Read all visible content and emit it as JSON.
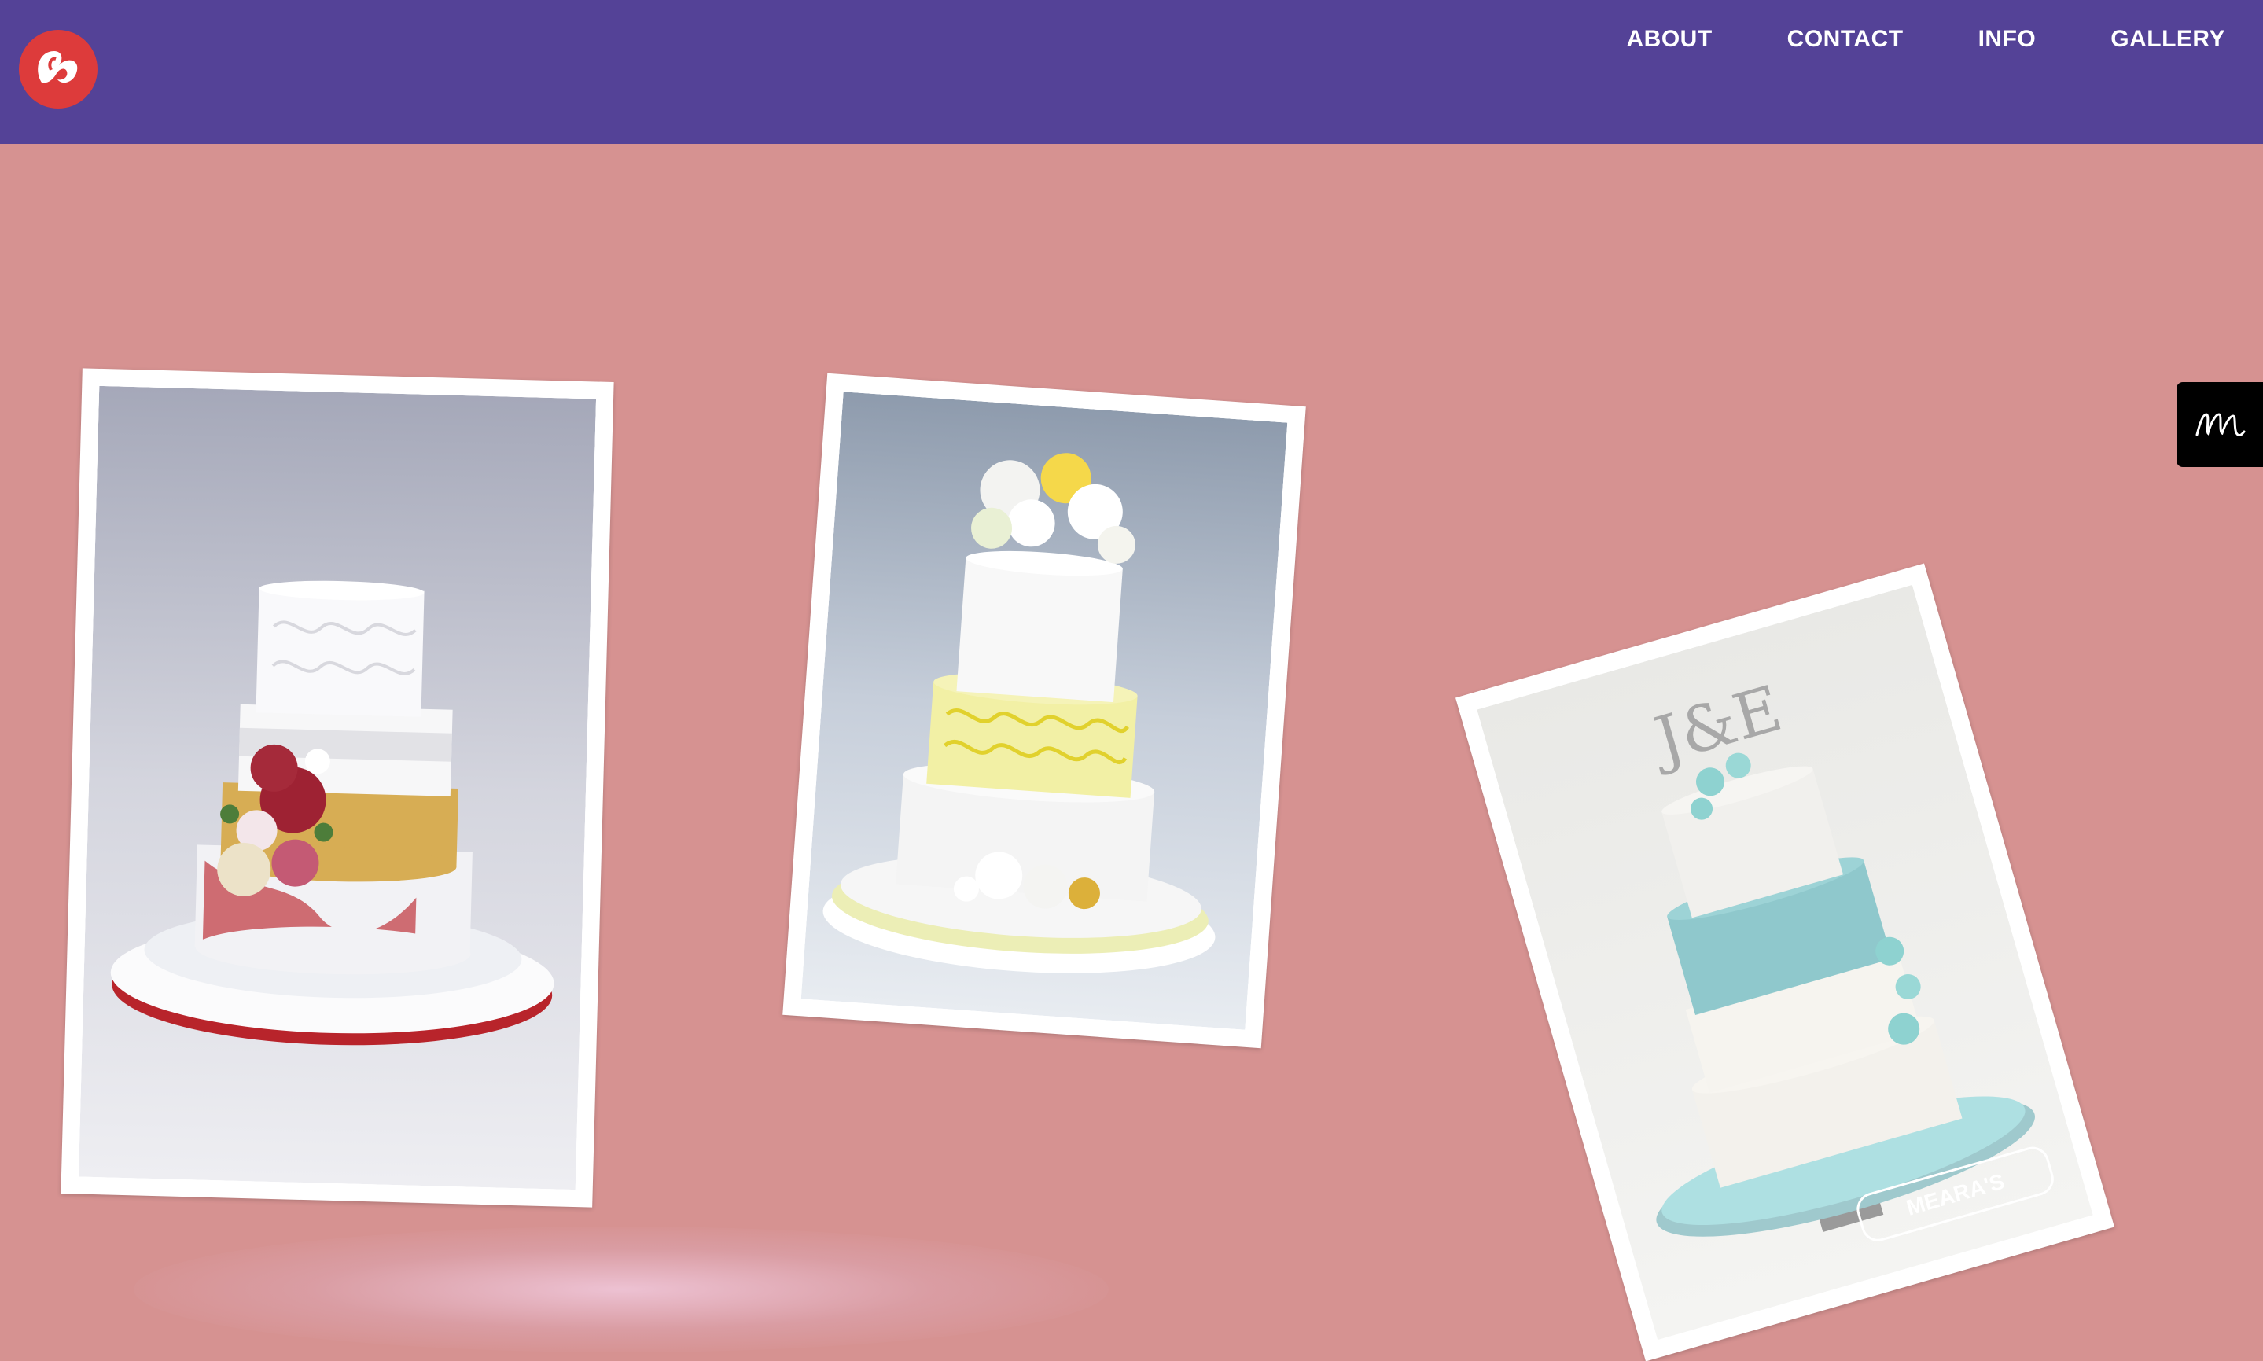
{
  "header": {
    "logo_name": "meara-logo-icon",
    "nav": [
      {
        "label": "ABOUT"
      },
      {
        "label": "CONTACT"
      },
      {
        "label": "INFO"
      },
      {
        "label": "GALLERY"
      }
    ]
  },
  "side_tab": {
    "icon": "m-script-icon",
    "glyph": "m"
  },
  "gallery": {
    "photos": [
      {
        "subject": "Four-tier white wedding cake with red and pink sugar roses and red marble bottom tier"
      },
      {
        "subject": "Three-tier white and yellow wedding cake with white and yellow flower topper"
      },
      {
        "subject": "Four-tier white and turquoise wedding cake with J&E monogram topper and blue orchids",
        "monogram": "J&E",
        "watermark": "MEARA'S"
      }
    ]
  },
  "colors": {
    "header": "#544297",
    "background": "#d69291",
    "logo": "#dd3b3b"
  }
}
